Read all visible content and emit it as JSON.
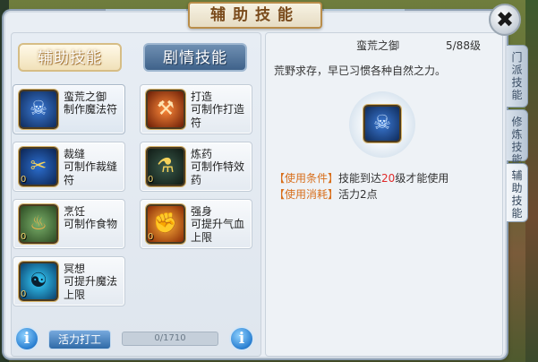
{
  "window": {
    "title": "辅助技能",
    "close_label": "✖"
  },
  "tabs": [
    {
      "label": "辅助技能",
      "active": true
    },
    {
      "label": "剧情技能",
      "active": false
    }
  ],
  "skills": [
    {
      "name": "蛮荒之御",
      "desc": "制作魔法符",
      "level": "",
      "icon": "demon-mask-icon"
    },
    {
      "name": "打造",
      "desc": "可制作打造符",
      "level": "",
      "icon": "hammer-anvil-icon"
    },
    {
      "name": "裁缝",
      "desc": "可制作裁缝符",
      "level": "0",
      "icon": "scissors-icon"
    },
    {
      "name": "炼药",
      "desc": "可制作特效药",
      "level": "0",
      "icon": "cauldron-icon"
    },
    {
      "name": "烹饪",
      "desc": "可制作食物",
      "level": "0",
      "icon": "cooking-pot-icon"
    },
    {
      "name": "强身",
      "desc": "可提升气血上限",
      "level": "0",
      "icon": "strength-icon"
    },
    {
      "name": "冥想",
      "desc": "可提升魔法上限",
      "level": "0",
      "icon": "meditation-icon"
    }
  ],
  "bottom": {
    "work_button": "活力打工",
    "energy_text": "0/1710",
    "energy_fraction": 0,
    "info_label": "i"
  },
  "detail": {
    "name": "蛮荒之御",
    "level": "5/88级",
    "description": "荒野求存，早已习惯各种自然之力。",
    "condition_tag": "【使用条件】",
    "condition_pre": "技能到达",
    "condition_level": "20",
    "condition_post": "级才能使用",
    "cost_tag": "【使用消耗】",
    "cost_text": "活力2点"
  },
  "side_tabs": [
    {
      "label": "门派技能",
      "active": false
    },
    {
      "label": "修炼技能",
      "active": false
    },
    {
      "label": "辅助技能",
      "active": true
    }
  ],
  "colors": {
    "accent_orange": "#d86f1c",
    "highlight_red": "#e02a2a",
    "tab_blue": "#3f628a"
  }
}
